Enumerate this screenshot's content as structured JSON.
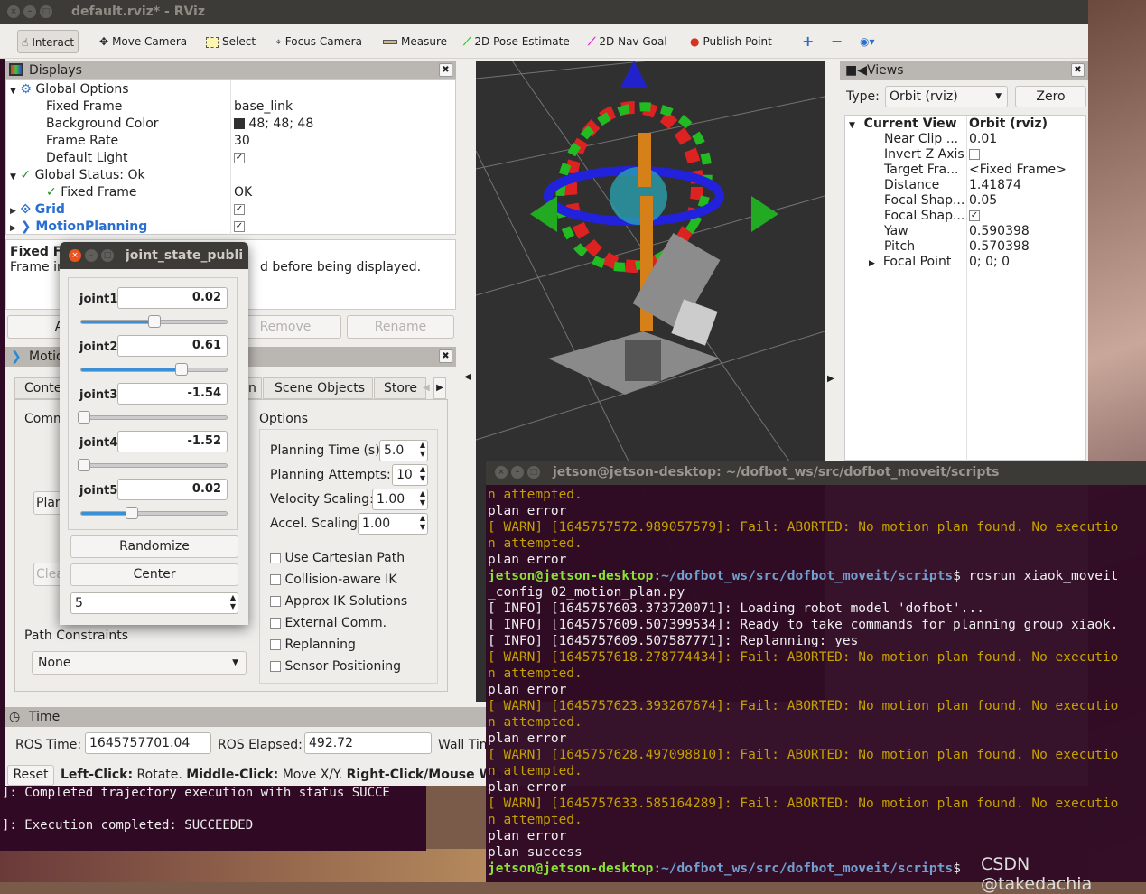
{
  "window": {
    "title": "default.rviz* - RViz"
  },
  "toolbar": {
    "items": [
      {
        "label": "Interact",
        "icon": "hand-pointer-icon"
      },
      {
        "label": "Move Camera",
        "icon": "move-camera-icon"
      },
      {
        "label": "Select",
        "icon": "select-box-icon"
      },
      {
        "label": "Focus Camera",
        "icon": "crosshair-icon"
      },
      {
        "label": "Measure",
        "icon": "ruler-icon"
      },
      {
        "label": "2D Pose Estimate",
        "icon": "green-arrow-icon"
      },
      {
        "label": "2D Nav Goal",
        "icon": "magenta-arrow-icon"
      },
      {
        "label": "Publish Point",
        "icon": "map-pin-icon"
      }
    ]
  },
  "displays": {
    "title": "Displays",
    "rows": [
      {
        "label": "Global Options",
        "value": ""
      },
      {
        "label": "Fixed Frame",
        "value": "base_link"
      },
      {
        "label": "Background Color",
        "value": "48; 48; 48"
      },
      {
        "label": "Frame Rate",
        "value": "30"
      },
      {
        "label": "Default Light",
        "value": "✓"
      },
      {
        "label": "Global Status: Ok",
        "value": ""
      },
      {
        "label": "Fixed Frame",
        "value": "OK"
      },
      {
        "label": "Grid",
        "value": "✓"
      },
      {
        "label": "MotionPlanning",
        "value": "✓"
      }
    ],
    "desc_title": "Fixed Fr",
    "desc_text_a": "Frame in",
    "desc_text_b": "d before being displayed.",
    "buttons": {
      "add": "Ad",
      "remove": "Remove",
      "rename": "Rename"
    }
  },
  "motion": {
    "title": "Motio",
    "tabs": [
      "Conte",
      "n",
      "Scene Objects",
      "Store"
    ],
    "commands_label": "Comm",
    "plan_label": "Plan",
    "clear_label": "Clea",
    "options_label": "Options",
    "planning_time_label": "Planning Time (s):",
    "planning_time": "5.0",
    "planning_attempts_label": "Planning Attempts:",
    "planning_attempts": "10",
    "velocity_label": "Velocity Scaling:",
    "velocity": "1.00",
    "accel_label": "Accel. Scaling:",
    "accel": "1.00",
    "checkboxes": [
      "Use Cartesian Path",
      "Collision-aware IK",
      "Approx IK Solutions",
      "External Comm.",
      "Replanning",
      "Sensor Positioning"
    ],
    "path_constraints_label": "Path Constraints",
    "path_constraints": "None"
  },
  "jsp": {
    "title": "joint_state_publis",
    "joints": [
      {
        "name": "joint1",
        "value": "0.02",
        "fraction": 0.5
      },
      {
        "name": "joint2",
        "value": "0.61",
        "fraction": 0.69
      },
      {
        "name": "joint3",
        "value": "-1.54",
        "fraction": 0.02
      },
      {
        "name": "joint4",
        "value": "-1.52",
        "fraction": 0.02
      },
      {
        "name": "joint5",
        "value": "0.02",
        "fraction": 0.35
      }
    ],
    "randomize": "Randomize",
    "center": "Center",
    "count": "5"
  },
  "views": {
    "title": "Views",
    "type_label": "Type:",
    "type_value": "Orbit (rviz)",
    "zero": "Zero",
    "rows": [
      {
        "label": "Current View",
        "value": "Orbit (rviz)"
      },
      {
        "label": "Near Clip ...",
        "value": "0.01"
      },
      {
        "label": "Invert Z Axis",
        "value": ""
      },
      {
        "label": "Target Fra...",
        "value": "<Fixed Frame>"
      },
      {
        "label": "Distance",
        "value": "1.41874"
      },
      {
        "label": "Focal Shap...",
        "value": "0.05"
      },
      {
        "label": "Focal Shap...",
        "value": "✓"
      },
      {
        "label": "Yaw",
        "value": "0.590398"
      },
      {
        "label": "Pitch",
        "value": "0.570398"
      },
      {
        "label": "Focal Point",
        "value": "0; 0; 0"
      }
    ]
  },
  "time": {
    "title": "Time",
    "ros_time_label": "ROS Time:",
    "ros_time": "1645757701.04",
    "ros_elapsed_label": "ROS Elapsed:",
    "ros_elapsed": "492.72",
    "wall_label": "Wall Tim"
  },
  "statusbar": {
    "reset": "Reset",
    "lc": "Left-Click:",
    "lc_t": " Rotate. ",
    "mc": "Middle-Click:",
    "mc_t": " Move X/Y. ",
    "rc": "Right-Click/Mouse Whee"
  },
  "bg_terminal": {
    "lines": [
      "]: Completed trajectory execution with status SUCCE",
      "]: Execution completed: SUCCEEDED"
    ]
  },
  "terminal": {
    "title": "jetson@jetson-desktop: ~/dofbot_ws/src/dofbot_moveit/scripts",
    "prompt_user": "jetson@jetson-desktop",
    "prompt_path": "~/dofbot_ws/src/dofbot_moveit/scripts",
    "lines": [
      {
        "t": "n attempted.",
        "c": "warn"
      },
      {
        "t": "plan error",
        "c": ""
      },
      {
        "t": "[ WARN] [1645757572.989057579]: Fail: ABORTED: No motion plan found. No executio",
        "c": "warn"
      },
      {
        "t": "n attempted.",
        "c": "warn"
      },
      {
        "t": "plan error",
        "c": ""
      },
      {
        "t": "PROMPT",
        "c": "$ rosrun xiaok_moveit"
      },
      {
        "t": "_config 02_motion_plan.py",
        "c": ""
      },
      {
        "t": "[ INFO] [1645757603.373720071]: Loading robot model 'dofbot'...",
        "c": ""
      },
      {
        "t": "[ INFO] [1645757609.507399534]: Ready to take commands for planning group xiaok.",
        "c": ""
      },
      {
        "t": "[ INFO] [1645757609.507587771]: Replanning: yes",
        "c": ""
      },
      {
        "t": "[ WARN] [1645757618.278774434]: Fail: ABORTED: No motion plan found. No executio",
        "c": "warn"
      },
      {
        "t": "n attempted.",
        "c": "warn"
      },
      {
        "t": "plan error",
        "c": ""
      },
      {
        "t": "[ WARN] [1645757623.393267674]: Fail: ABORTED: No motion plan found. No executio",
        "c": "warn"
      },
      {
        "t": "n attempted.",
        "c": "warn"
      },
      {
        "t": "plan error",
        "c": ""
      },
      {
        "t": "[ WARN] [1645757628.497098810]: Fail: ABORTED: No motion plan found. No executio",
        "c": "warn"
      },
      {
        "t": "n attempted.",
        "c": "warn"
      },
      {
        "t": "plan error",
        "c": ""
      },
      {
        "t": "[ WARN] [1645757633.585164289]: Fail: ABORTED: No motion plan found. No executio",
        "c": "warn"
      },
      {
        "t": "n attempted.",
        "c": "warn"
      },
      {
        "t": "plan error",
        "c": ""
      },
      {
        "t": "plan success",
        "c": ""
      },
      {
        "t": "PROMPT",
        "c": "$ "
      }
    ]
  },
  "watermark": "CSDN @takedachia"
}
